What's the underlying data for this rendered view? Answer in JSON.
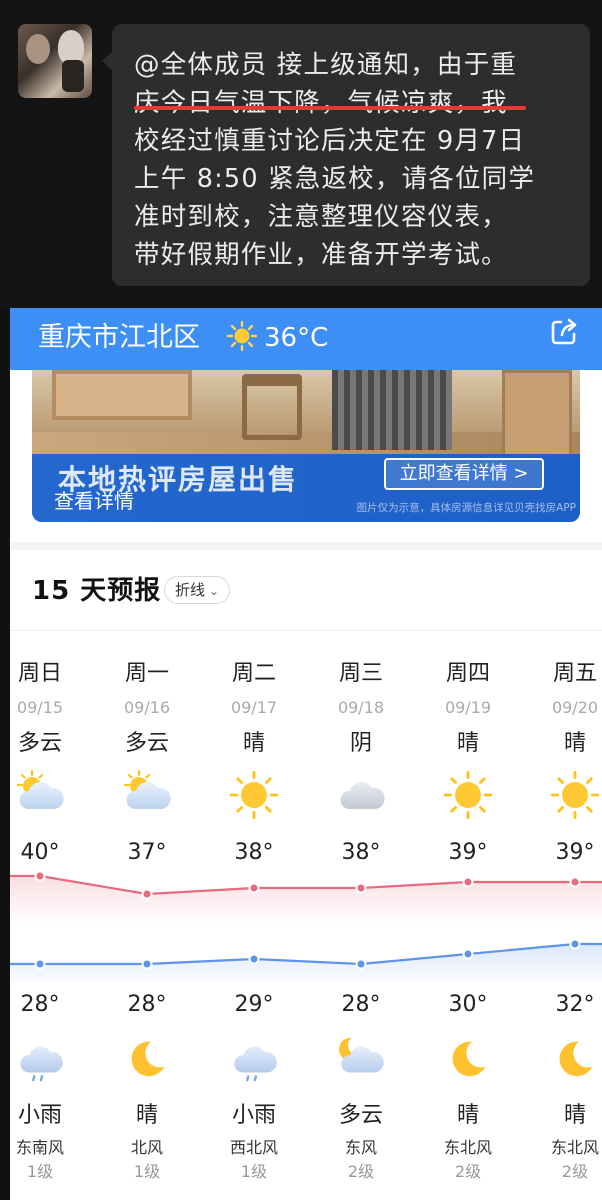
{
  "chat": {
    "message_lines": [
      "@全体成员 接上级通知，由于重",
      "庆今日气温下降，气候凉爽，我",
      "校经过慎重讨论后决定在 9月7日",
      "上午 8:50 紧急返校，请各位同学",
      "准时到校，注意整理仪容仪表，",
      "带好假期作业，准备开学考试。"
    ],
    "underline_color": "#e53935"
  },
  "app": {
    "location": "重庆市江北区",
    "current_temp": "36°C",
    "header_color": "#3d8ff5",
    "share_icon": "share-icon"
  },
  "ad": {
    "title": "本地热评房屋出售",
    "button": "立即查看详情 >",
    "link": "查看详情",
    "note": "图片仅为示意，具体房源信息详见贝壳找房APP"
  },
  "forecast": {
    "title": "15 天预报",
    "toggle": "折线",
    "days": [
      {
        "dow": "周日",
        "date": "09/15",
        "day_cond": "多云",
        "day_icon": "partly-cloudy-icon",
        "high": "40°",
        "low": "28°",
        "night_icon": "rain-cloud-icon",
        "night_cond": "小雨",
        "wind": "东南风",
        "wind_level": "1级"
      },
      {
        "dow": "周一",
        "date": "09/16",
        "day_cond": "多云",
        "day_icon": "partly-cloudy-icon",
        "high": "37°",
        "low": "28°",
        "night_icon": "moon-icon",
        "night_cond": "晴",
        "wind": "北风",
        "wind_level": "1级"
      },
      {
        "dow": "周二",
        "date": "09/17",
        "day_cond": "晴",
        "day_icon": "sun-icon",
        "high": "38°",
        "low": "29°",
        "night_icon": "rain-cloud-icon",
        "night_cond": "小雨",
        "wind": "西北风",
        "wind_level": "1级"
      },
      {
        "dow": "周三",
        "date": "09/18",
        "day_cond": "阴",
        "day_icon": "cloud-icon",
        "high": "38°",
        "low": "28°",
        "night_icon": "moon-cloud-icon",
        "night_cond": "多云",
        "wind": "东风",
        "wind_level": "2级"
      },
      {
        "dow": "周四",
        "date": "09/19",
        "day_cond": "晴",
        "day_icon": "sun-icon",
        "high": "39°",
        "low": "30°",
        "night_icon": "moon-icon",
        "night_cond": "晴",
        "wind": "东北风",
        "wind_level": "2级"
      },
      {
        "dow": "周五",
        "date": "09/20",
        "day_cond": "晴",
        "day_icon": "sun-icon",
        "high": "39°",
        "low": "32°",
        "night_icon": "moon-icon",
        "night_cond": "晴",
        "wind": "东北风",
        "wind_level": "2级"
      }
    ]
  },
  "chart_data": {
    "type": "line",
    "x": [
      "09/15",
      "09/16",
      "09/17",
      "09/18",
      "09/19",
      "09/20"
    ],
    "series": [
      {
        "values": [
          40,
          37,
          38,
          38,
          39,
          39
        ],
        "color": "#e86a7e"
      },
      {
        "values": [
          28,
          28,
          29,
          28,
          30,
          32
        ],
        "color": "#5f95e8"
      }
    ]
  }
}
